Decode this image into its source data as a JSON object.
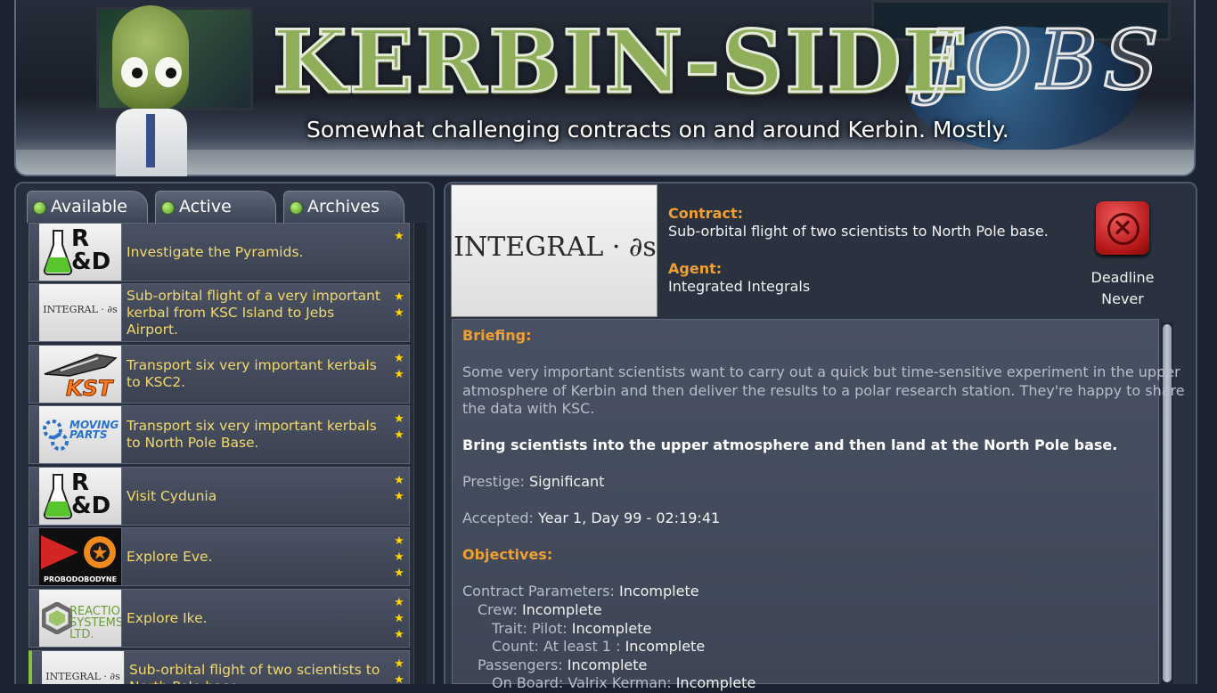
{
  "banner": {
    "title": "KERBIN-SIDE",
    "title_script": "JOBS",
    "subtitle": "Somewhat challenging contracts on and around Kerbin. Mostly."
  },
  "tabs": [
    {
      "label": "Available",
      "status_color": "#4c9b1d"
    },
    {
      "label": "Active",
      "status_color": "#4c9b1d"
    },
    {
      "label": "Archives",
      "status_color": "#4c9b1d"
    }
  ],
  "contracts": [
    {
      "title": "Investigate the Pyramids.",
      "logo": "rd-flask-logo",
      "logo_text": "R&D",
      "stars": "★"
    },
    {
      "title": "Sub-orbital flight of a very important kerbal from KSC Island to Jebs Airport.",
      "logo": "integral-logo",
      "logo_text": "INTEGRAL · ∂s",
      "stars": "★★"
    },
    {
      "title": "Transport six very important kerbals to KSC2.",
      "logo": "kst-logo",
      "logo_text": "KST",
      "stars": "★★"
    },
    {
      "title": "Transport six very important kerbals to North Pole Base.",
      "logo": "moving-parts-logo",
      "logo_text": "MOVING PARTS",
      "stars": "★★"
    },
    {
      "title": "Visit Cydunia",
      "logo": "rd-flask-logo",
      "logo_text": "R&D",
      "stars": "★★"
    },
    {
      "title": "Explore Eve.",
      "logo": "probodobodyne-logo",
      "logo_text": "PROBODOBODYNE",
      "stars": "★★★"
    },
    {
      "title": "Explore Ike.",
      "logo": "reaction-systems-logo",
      "logo_text": "REACTION SYSTEMS LTD.",
      "stars": "★★★"
    },
    {
      "title": "Sub-orbital flight of two scientists to North Pole base.",
      "logo": "integral-logo",
      "logo_text": "INTEGRAL · ∂s",
      "stars": "★★"
    }
  ],
  "detail": {
    "agency_logo_text": "INTEGRAL · ∂s",
    "contract_label": "Contract:",
    "contract_value": "Sub-orbital flight of two scientists to North Pole base.",
    "agent_label": "Agent:",
    "agent_value": "Integrated Integrals",
    "deadline_label": "Deadline",
    "deadline_value": "Never",
    "decline_icon": "⊗",
    "briefing_label": "Briefing:",
    "briefing_lines": [
      "Some very important scientists want to carry out a quick but time-sensitive experiment in the upper",
      "atmosphere of Kerbin and then deliver the results to a polar research station. They're happy to share",
      "the data with KSC."
    ],
    "synopsis": "Bring scientists into the upper atmosphere and then land at the North Pole base.",
    "prestige_label": "Prestige:",
    "prestige_value": "Significant",
    "accepted_label": "Accepted:",
    "accepted_value": "Year 1, Day 99 - 02:19:41",
    "objectives_label": "Objectives:",
    "objectives": [
      {
        "label": "Contract Parameters:",
        "value": "Incomplete"
      },
      {
        "label": "Crew:",
        "value": "Incomplete"
      },
      {
        "label": "Trait: Pilot:",
        "value": "Incomplete"
      },
      {
        "label": "Count: At least 1 :",
        "value": "Incomplete"
      },
      {
        "label": "Passengers:",
        "value": "Incomplete"
      },
      {
        "label": "On Board: Valrix Kerman:",
        "value": "Incomplete"
      }
    ]
  },
  "colors": {
    "accent_orange": "#f0a030",
    "item_text_yellow": "#f3d86c",
    "star_yellow": "#ffd400",
    "decline_red": "#b31616",
    "status_green": "#4c9b1d"
  }
}
